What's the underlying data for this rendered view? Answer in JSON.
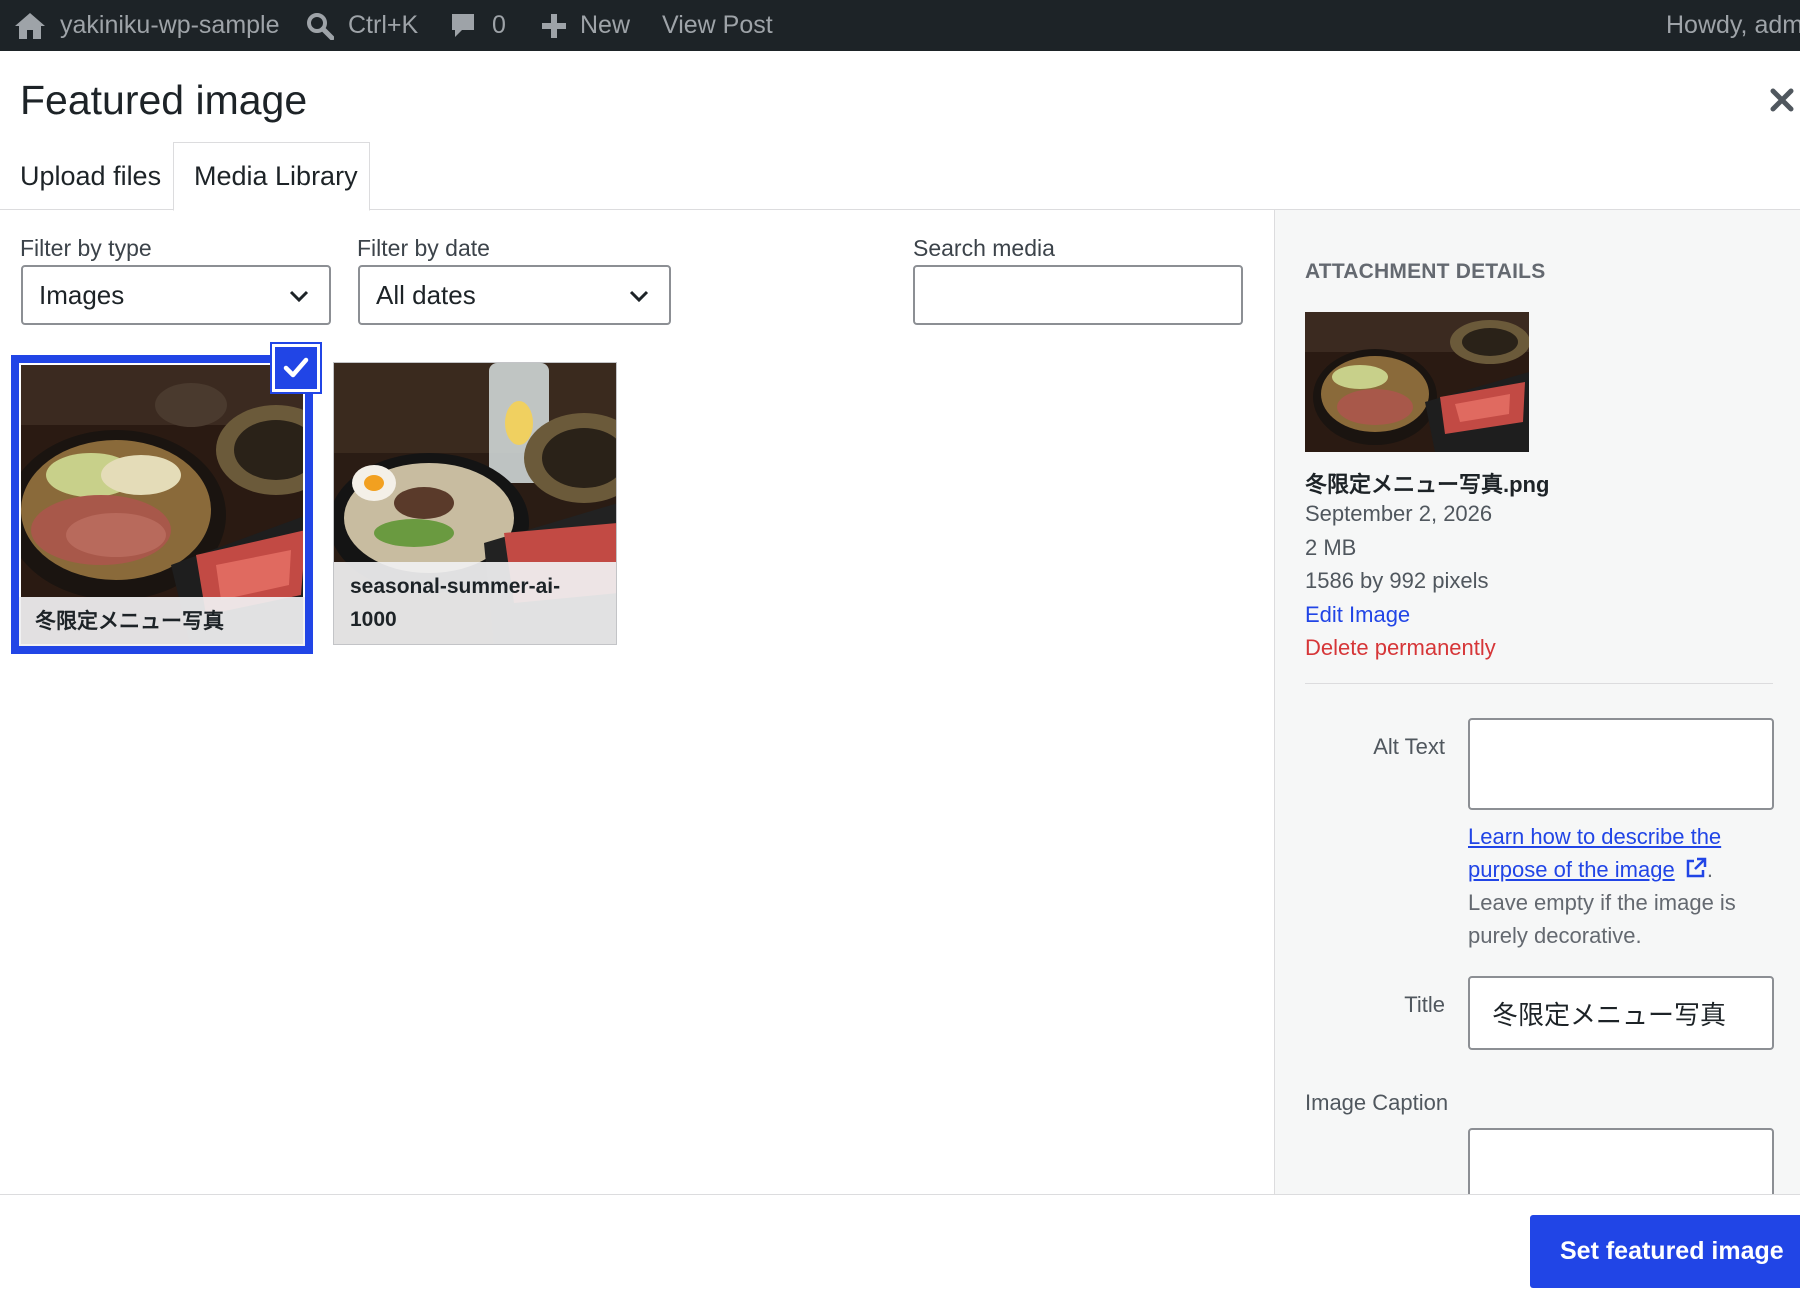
{
  "adminbar": {
    "site_name": "yakiniku-wp-sample",
    "search_shortcut": "Ctrl+K",
    "comments_count": "0",
    "new_label": "New",
    "view_post_label": "View Post",
    "howdy_label": "Howdy, adm"
  },
  "modal": {
    "title": "Featured image",
    "tabs": [
      {
        "label": "Upload files"
      },
      {
        "label": "Media Library",
        "active": true
      }
    ]
  },
  "filters": {
    "type_label": "Filter by type",
    "type_value": "Images",
    "date_label": "Filter by date",
    "date_value": "All dates",
    "search_label": "Search media",
    "search_value": ""
  },
  "media_items": [
    {
      "caption": "冬限定メニュー写真",
      "selected": true
    },
    {
      "caption": "seasonal-summer-ai-1000",
      "selected": false
    }
  ],
  "attachment": {
    "heading": "ATTACHMENT DETAILS",
    "filename": "冬限定メニュー写真.png",
    "date": "September 2, 2026",
    "size": "2 MB",
    "dimensions": "1586 by 992 pixels",
    "edit_label": "Edit Image",
    "delete_label": "Delete permanently",
    "alt_text_label": "Alt Text",
    "alt_text_value": "",
    "help_link": "Learn how to describe the purpose of the image",
    "help_text": "Leave empty if the image is purely decorative.",
    "title_label": "Title",
    "title_value": "冬限定メニュー写真",
    "caption_label": "Image Caption",
    "caption_value": ""
  },
  "footer": {
    "set_button": "Set featured image"
  },
  "colors": {
    "accent": "#2145e6",
    "danger": "#d63638",
    "adminbar_bg": "#1d2327"
  }
}
